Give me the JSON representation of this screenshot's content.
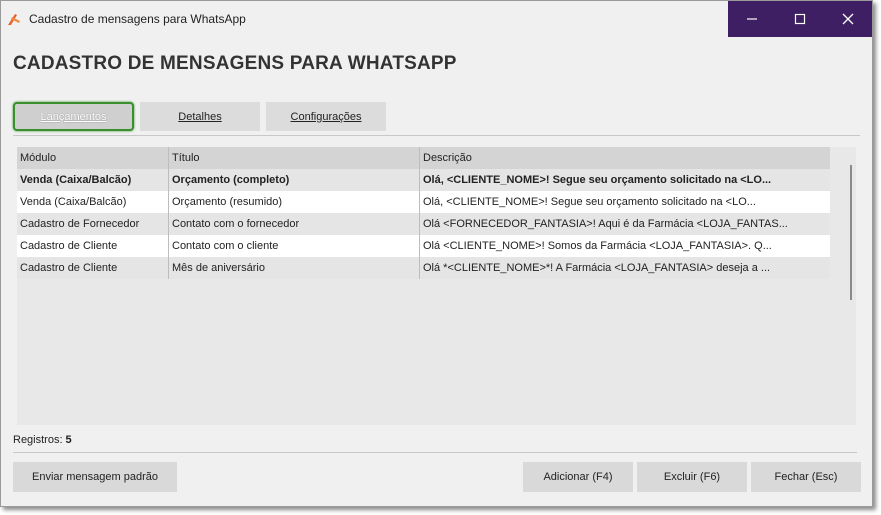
{
  "window": {
    "title": "Cadastro de mensagens para WhatsApp",
    "accent": "#3e1f63"
  },
  "heading": "CADASTRO DE MENSAGENS PARA WHATSAPP",
  "tabs": [
    {
      "label": "Lançamentos",
      "active": true
    },
    {
      "label": "Detalhes",
      "active": false
    },
    {
      "label": "Configurações",
      "active": false
    }
  ],
  "table": {
    "columns": [
      "Módulo",
      "Título",
      "Descrição"
    ],
    "rows": [
      {
        "modulo": "Venda (Caixa/Balcão)",
        "titulo": "Orçamento (completo)",
        "descricao": "Olá, <CLIENTE_NOME>!  Segue seu orçamento solicitado na <LO...",
        "selected": true
      },
      {
        "modulo": "Venda (Caixa/Balcão)",
        "titulo": "Orçamento (resumido)",
        "descricao": "Olá, <CLIENTE_NOME>!  Segue seu orçamento solicitado na <LO..."
      },
      {
        "modulo": "Cadastro de Fornecedor",
        "titulo": "Contato com o fornecedor",
        "descricao": "Olá <FORNECEDOR_FANTASIA>!  Aqui é da Farmácia <LOJA_FANTAS..."
      },
      {
        "modulo": "Cadastro de Cliente",
        "titulo": "Contato com o cliente",
        "descricao": "Olá <CLIENTE_NOME>!  Somos da Farmácia <LOJA_FANTASIA>.  Q..."
      },
      {
        "modulo": "Cadastro de Cliente",
        "titulo": "Mês de aniversário",
        "descricao": "Olá *<CLIENTE_NOME>*!  A Farmácia <LOJA_FANTASIA> deseja a ..."
      }
    ]
  },
  "status": {
    "registros_label": "Registros:",
    "registros_count": "5"
  },
  "buttons": {
    "send_default": "Enviar mensagem padrão",
    "add": "Adicionar (F4)",
    "delete": "Excluir (F6)",
    "close": "Fechar (Esc)"
  },
  "icons": {
    "app": "app-logo-icon",
    "minimize": "minimize-icon",
    "maximize": "maximize-icon",
    "close": "close-icon"
  }
}
